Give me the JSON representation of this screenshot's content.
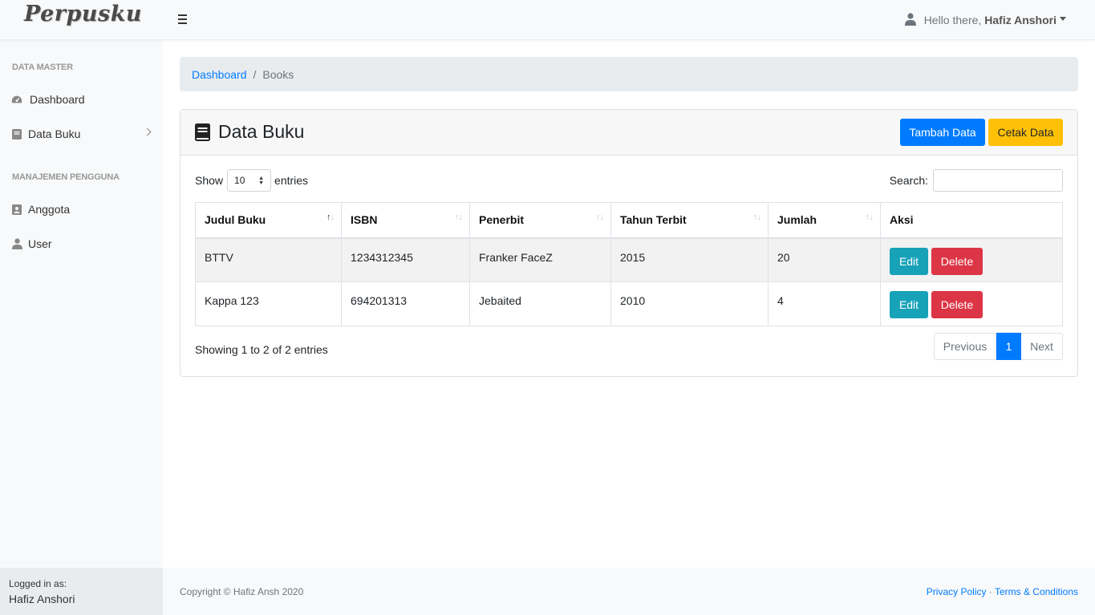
{
  "navbar": {
    "brand": "Perpusku",
    "greeting": "Hello there,",
    "user_name": "Hafiz Anshori"
  },
  "sidebar": {
    "heading_master": "DATA MASTER",
    "heading_users": "MANAJEMEN PENGGUNA",
    "items": [
      {
        "label": "Dashboard",
        "icon": "tachometer-icon"
      },
      {
        "label": "Data Buku",
        "icon": "book-icon"
      },
      {
        "label": "Anggota",
        "icon": "id-card-icon"
      },
      {
        "label": "User",
        "icon": "user-icon"
      }
    ],
    "logged_in_label": "Logged in as:",
    "logged_in_name": "Hafiz Anshori"
  },
  "breadcrumb": {
    "home": "Dashboard",
    "separator": "/",
    "current": "Books"
  },
  "card": {
    "title": "Data Buku",
    "add_button": "Tambah Data",
    "print_button": "Cetak Data"
  },
  "datatable": {
    "show_label": "Show",
    "entries_label": "entries",
    "page_length": "10",
    "search_label": "Search:",
    "search_value": "",
    "columns": [
      "Judul Buku",
      "ISBN",
      "Penerbit",
      "Tahun Terbit",
      "Jumlah",
      "Aksi"
    ],
    "rows": [
      {
        "judul": "BTTV",
        "isbn": "1234312345",
        "penerbit": "Franker FaceZ",
        "tahun": "2015",
        "jumlah": "20"
      },
      {
        "judul": "Kappa 123",
        "isbn": "694201313",
        "penerbit": "Jebaited",
        "tahun": "2010",
        "jumlah": "4"
      }
    ],
    "edit_label": "Edit",
    "delete_label": "Delete",
    "info": "Showing 1 to 2 of 2 entries",
    "prev_label": "Previous",
    "current_page": "1",
    "next_label": "Next"
  },
  "footer": {
    "copyright": "Copyright © Hafiz Ansh 2020",
    "privacy": "Privacy Policy",
    "dot": "·",
    "terms": "Terms & Conditions"
  },
  "colors": {
    "primary": "#007bff",
    "warning": "#ffc107",
    "info": "#17a2b8",
    "danger": "#dc3545"
  }
}
